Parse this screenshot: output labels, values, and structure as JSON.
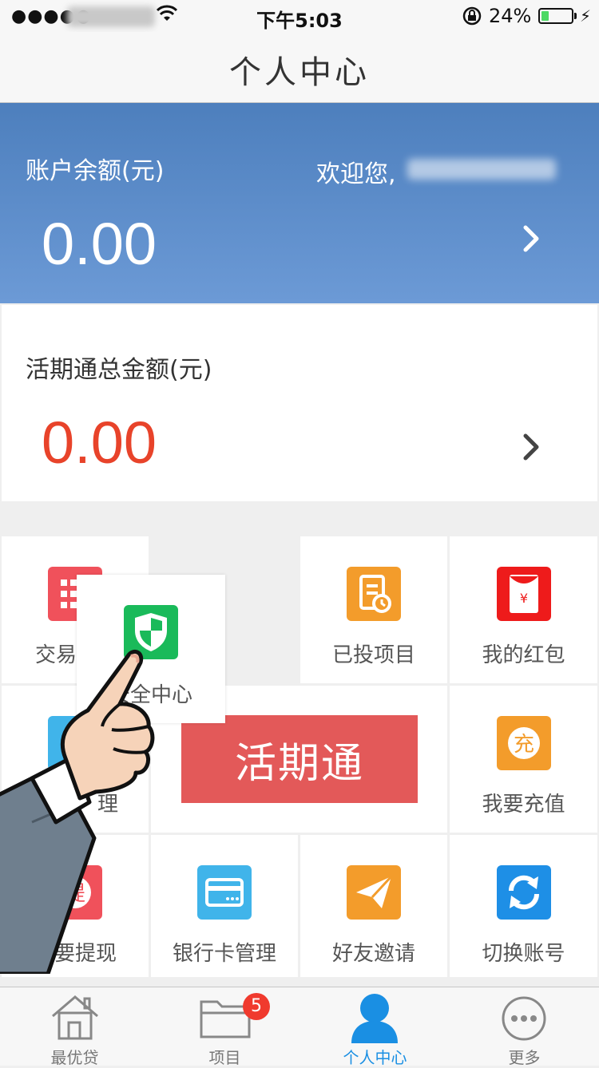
{
  "status_bar": {
    "time": "下午5:03",
    "battery_percent": "24%",
    "battery_level": 0.24
  },
  "navbar": {
    "title": "个人中心"
  },
  "balance_card": {
    "label": "账户余额(元)",
    "welcome": "欢迎您,",
    "amount": "0.00"
  },
  "current_card": {
    "label": "活期通总金额(元)",
    "amount": "0.00"
  },
  "grid": {
    "items": [
      {
        "label": "交易",
        "icon": "list-icon",
        "color": "#f0515b"
      },
      {
        "label": "已投项目",
        "icon": "document-clock-icon",
        "color": "#f39c2b"
      },
      {
        "label": "我的红包",
        "icon": "red-envelope-icon",
        "color": "#ee1b1b"
      },
      {
        "label": "理",
        "icon": "manage-icon",
        "color": "#40b4ea"
      },
      {
        "label": "我要充值",
        "icon": "recharge-icon",
        "color": "#f39c2b"
      },
      {
        "label": "我要提现",
        "icon": "withdraw-icon",
        "color": "#f0515b"
      },
      {
        "label": "银行卡管理",
        "icon": "bank-card-icon",
        "color": "#40b4ea"
      },
      {
        "label": "好友邀请",
        "icon": "paper-plane-icon",
        "color": "#f39c2b"
      },
      {
        "label": "切换账号",
        "icon": "switch-account-icon",
        "color": "#1e8fe6"
      }
    ],
    "banner": "活期通",
    "popup_label": "安全中心"
  },
  "tabbar": {
    "tabs": [
      {
        "label": "最优贷",
        "icon": "home-icon"
      },
      {
        "label": "项目",
        "icon": "folder-icon",
        "badge": "5"
      },
      {
        "label": "个人中心",
        "icon": "person-icon",
        "active": true
      },
      {
        "label": "更多",
        "icon": "more-icon"
      }
    ]
  },
  "colors": {
    "accent": "#1a8fe3",
    "header_blue": "#5a8bcb",
    "amount_red": "#e8432a",
    "security_green": "#1aba5a"
  }
}
